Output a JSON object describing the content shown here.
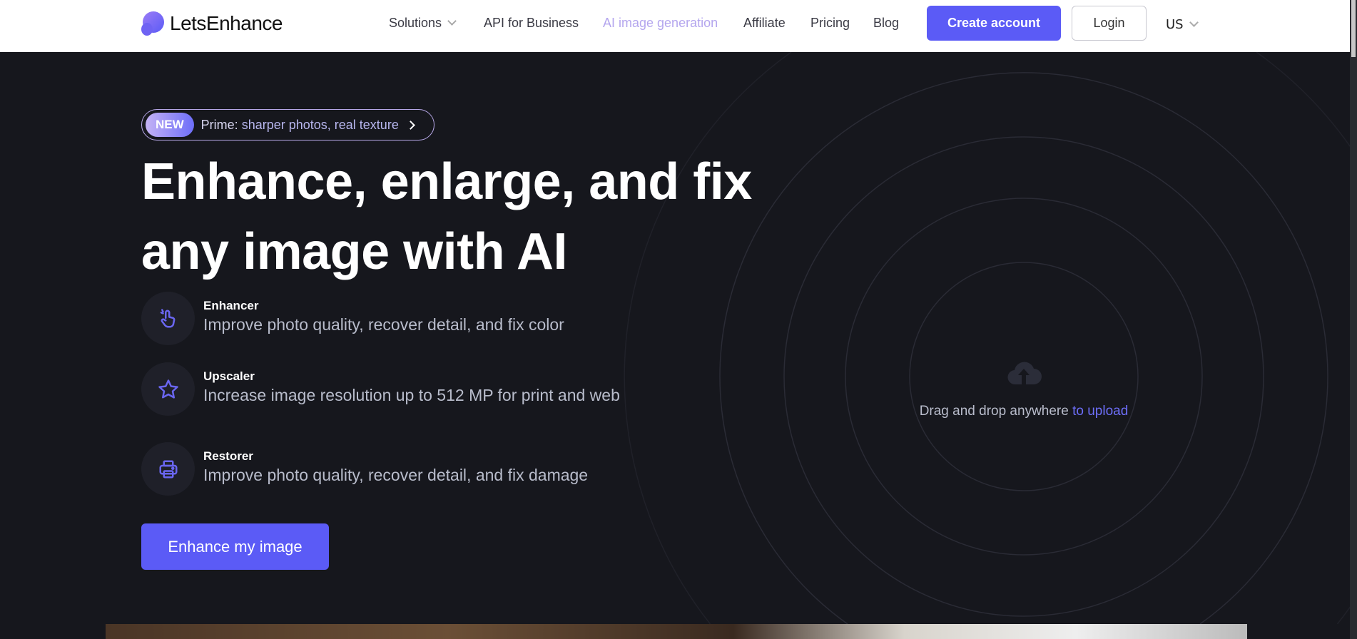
{
  "nav": {
    "logo": "LetsEnhance",
    "links": [
      "Solutions",
      "API for Business",
      "AI image generation",
      "Affiliate",
      "Pricing",
      "Blog"
    ],
    "create_account": "Create account",
    "login": "Login",
    "language": "US"
  },
  "hero": {
    "badge_new": "NEW",
    "badge_prefix": "Prime:",
    "badge_text": "sharper photos, real texture",
    "heading_line1": "Enhance, enlarge, and fix",
    "heading_line2": "any image with AI",
    "features": [
      {
        "title": "Enhancer",
        "desc": "Improve photo quality, recover detail, and fix color",
        "icon": "hand-pointer-icon"
      },
      {
        "title": "Upscaler",
        "desc": "Increase image resolution up to 512 MP for print and web",
        "icon": "star-icon"
      },
      {
        "title": "Restorer",
        "desc": "Improve photo quality, recover detail, and fix damage",
        "icon": "printer-icon"
      }
    ],
    "cta": "Enhance my image"
  },
  "upload": {
    "text": "Drag and drop anywhere",
    "link": "to upload"
  },
  "colors": {
    "accent": "#5b5bf6",
    "background": "#16171d",
    "ai_link": "#b4a6ee"
  }
}
